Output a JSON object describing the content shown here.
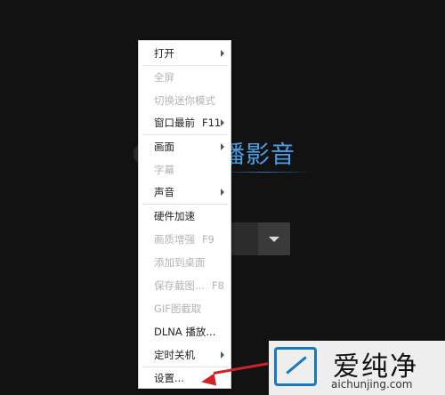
{
  "app": {
    "title": "播影音"
  },
  "context_menu": {
    "items": [
      {
        "label": "打开",
        "shortcut": "",
        "submenu": true,
        "disabled": false
      },
      {
        "label": "全屏",
        "shortcut": "",
        "submenu": false,
        "disabled": true
      },
      {
        "label": "切换迷你模式",
        "shortcut": "",
        "submenu": false,
        "disabled": true
      },
      {
        "label": "窗口最前",
        "shortcut": "F11",
        "submenu": true,
        "disabled": false
      },
      {
        "label": "画面",
        "shortcut": "",
        "submenu": true,
        "disabled": false
      },
      {
        "label": "字幕",
        "shortcut": "",
        "submenu": false,
        "disabled": true
      },
      {
        "label": "声音",
        "shortcut": "",
        "submenu": true,
        "disabled": false
      },
      {
        "label": "硬件加速",
        "shortcut": "",
        "submenu": false,
        "disabled": false
      },
      {
        "label": "画质增强",
        "shortcut": "F9",
        "submenu": false,
        "disabled": true
      },
      {
        "label": "添加到桌面",
        "shortcut": "",
        "submenu": false,
        "disabled": true
      },
      {
        "label": "保存截图...",
        "shortcut": "F8",
        "submenu": false,
        "disabled": true
      },
      {
        "label": "GIF图截取",
        "shortcut": "",
        "submenu": false,
        "disabled": true
      },
      {
        "label": "DLNA 播放...",
        "shortcut": "",
        "submenu": false,
        "disabled": false
      },
      {
        "label": "定时关机",
        "shortcut": "",
        "submenu": true,
        "disabled": false
      },
      {
        "label": "设置...",
        "shortcut": "",
        "submenu": false,
        "disabled": false
      }
    ]
  },
  "watermark": {
    "title": "爱纯净",
    "url": "aichunjing.com"
  },
  "colors": {
    "background": "#121212",
    "accent": "#4a9de4",
    "pointer": "#d31f26",
    "logo": "#1a78c2"
  }
}
